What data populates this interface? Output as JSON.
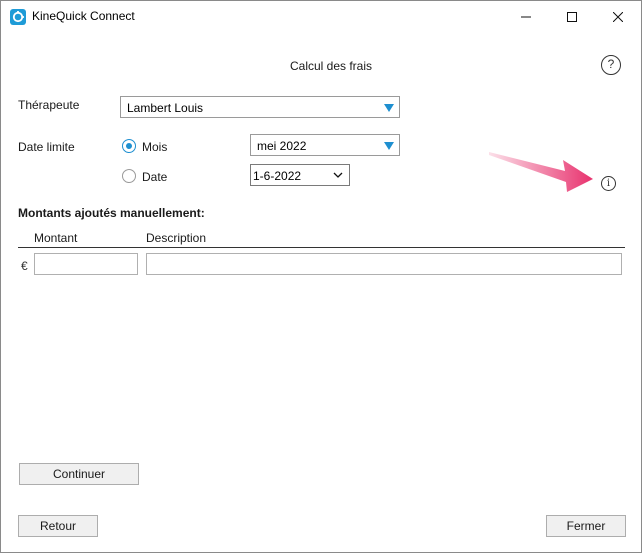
{
  "window": {
    "title": "KineQuick Connect",
    "icon": "kinequick-app-icon",
    "controls": [
      "minimize-icon",
      "maximize-icon",
      "close-icon"
    ]
  },
  "page": {
    "title": "Calcul des frais",
    "help_glyph": "?"
  },
  "form": {
    "therapist_label": "Thérapeute",
    "therapist_value": "Lambert Louis",
    "deadline_label": "Date limite",
    "option_month_label": "Mois",
    "option_date_label": "Date",
    "selected_option": "Mois",
    "month_value": "mei 2022",
    "date_value": "1-6-2022",
    "info_glyph": "i"
  },
  "manual_amounts": {
    "heading": "Montants ajoutés manuellement:",
    "columns": [
      "Montant",
      "Description"
    ],
    "currency_symbol": "€",
    "amount_value": "",
    "description_value": ""
  },
  "buttons": {
    "continue": "Continuer",
    "back": "Retour",
    "close": "Fermer"
  },
  "colors": {
    "accent": "#1e8fd0",
    "annotation_arrow": "#e8326e"
  }
}
